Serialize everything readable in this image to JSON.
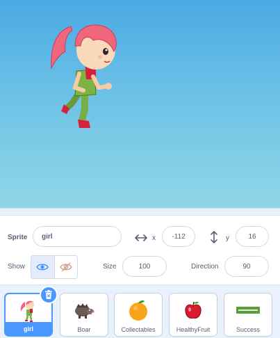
{
  "stage": {
    "sprite_icon": "girl-running-sprite"
  },
  "info": {
    "sprite_label": "Sprite",
    "sprite_name": "girl",
    "x_label": "x",
    "x_value": "-112",
    "y_label": "y",
    "y_value": "16",
    "show_label": "Show",
    "size_label": "Size",
    "size_value": "100",
    "direction_label": "Direction",
    "direction_value": "90",
    "show_visible_selected": true
  },
  "sprites": [
    {
      "name": "girl",
      "icon": "girl-sprite-icon",
      "selected": true
    },
    {
      "name": "Boar",
      "icon": "boar-sprite-icon",
      "selected": false
    },
    {
      "name": "Collectables",
      "icon": "orange-sprite-icon",
      "selected": false
    },
    {
      "name": "HealthyFruit",
      "icon": "apple-sprite-icon",
      "selected": false
    },
    {
      "name": "Success",
      "icon": "success-banner-icon",
      "selected": false
    }
  ],
  "colors": {
    "accent": "#4c97ff",
    "text": "#575e75",
    "stage_top": "#4aa9e4",
    "stage_bottom": "#8fd7e6"
  }
}
